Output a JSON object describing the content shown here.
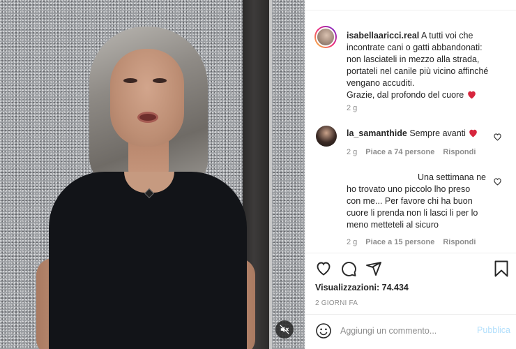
{
  "post": {
    "username": "isabellaaricci.real",
    "caption_lines": [
      "A tutti voi che",
      "incontrate cani o gatti abbandonati:",
      "non lasciateli in mezzo alla strada,",
      "portateli nel canile più vicino affinché",
      "vengano accuditi.",
      "Grazie, dal profondo del cuore"
    ],
    "age": "2 g"
  },
  "comments": [
    {
      "username": "la_samanthide",
      "text": "Sempre avanti",
      "age": "2 g",
      "likes": "Piace a 74 persone",
      "reply": "Rispondi"
    },
    {
      "username": "",
      "text_lines": [
        "Una settimana ne",
        "ho trovato uno piccolo lho preso",
        "con me... Per favore chi ha buon",
        "cuore li prenda non li lasci li per lo",
        "meno metteteli al sicuro"
      ],
      "age": "2 g",
      "likes": "Piace a 15 persone",
      "reply": "Rispondi"
    }
  ],
  "stats": {
    "views_label": "Visualizzazioni:",
    "views_value": "74.434",
    "date": "2 GIORNI FA"
  },
  "composer": {
    "placeholder": "Aggiungi un commento...",
    "publish": "Pubblica"
  },
  "icons": {
    "like": "heart-outline-icon",
    "comment": "comment-bubble-icon",
    "share": "paper-plane-icon",
    "save": "bookmark-icon",
    "emoji": "smiley-icon",
    "mute": "speaker-muted-icon"
  },
  "colors": {
    "heart_emoji": "#d7263d",
    "publish_disabled": "#b2dffc",
    "muted_text": "#8e8e8e"
  }
}
